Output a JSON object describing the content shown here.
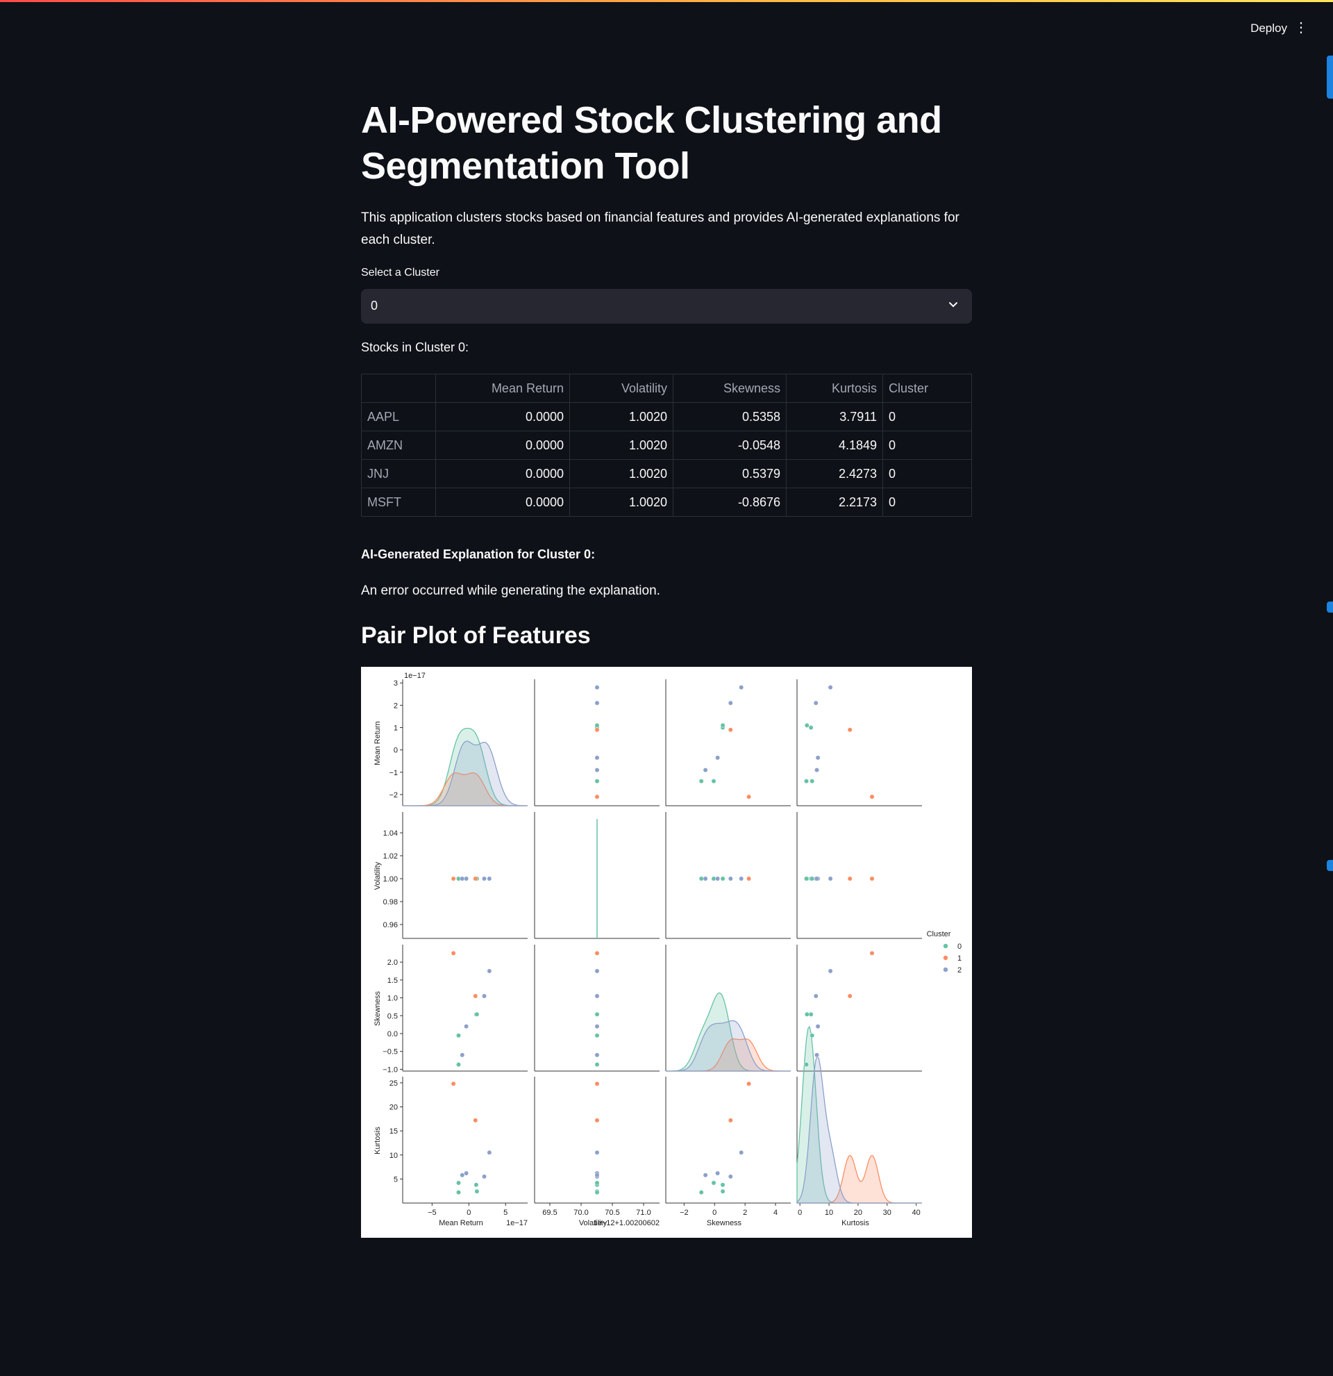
{
  "header": {
    "deploy_label": "Deploy",
    "menu_icon": "⋮"
  },
  "page": {
    "title": "AI-Powered Stock Clustering and Segmentation Tool",
    "description": "This application clusters stocks based on financial features and provides AI-generated explanations for each cluster."
  },
  "cluster_select": {
    "label": "Select a Cluster",
    "value": "0"
  },
  "stocks_label": "Stocks in Cluster 0:",
  "table": {
    "columns": [
      "",
      "Mean Return",
      "Volatility",
      "Skewness",
      "Kurtosis",
      "Cluster"
    ],
    "rows": [
      [
        "AAPL",
        "0.0000",
        "1.0020",
        "0.5358",
        "3.7911",
        "0"
      ],
      [
        "AMZN",
        "0.0000",
        "1.0020",
        "-0.0548",
        "4.1849",
        "0"
      ],
      [
        "JNJ",
        "0.0000",
        "1.0020",
        "0.5379",
        "2.4273",
        "0"
      ],
      [
        "MSFT",
        "0.0000",
        "1.0020",
        "-0.8676",
        "2.2173",
        "0"
      ]
    ]
  },
  "explanation": {
    "heading": "AI-Generated Explanation for Cluster 0:",
    "text": "An error occurred while generating the explanation."
  },
  "pairplot_heading": "Pair Plot of Features",
  "colors": {
    "c0": "#66c2a5",
    "c1": "#fc8d62",
    "c2": "#8da0cb",
    "bg": "#0e1117"
  },
  "chart_data": {
    "type": "scatter",
    "title": "",
    "variables": [
      "Mean Return",
      "Volatility",
      "Skewness",
      "Kurtosis"
    ],
    "offsets": {
      "Mean Return": "1e−17",
      "Volatility": "1e−12+1.00200602"
    },
    "legend": {
      "title": "Cluster",
      "entries": [
        "0",
        "1",
        "2"
      ],
      "placement": "right"
    },
    "ticks": {
      "Mean Return": {
        "x": [
          "−5",
          "0",
          "5"
        ],
        "y": [
          "3",
          "2",
          "1",
          "0",
          "−1",
          "−2"
        ]
      },
      "Volatility": {
        "x": [
          "69.5",
          "70.0",
          "70.5",
          "71.0"
        ],
        "y": [
          "1.04",
          "1.02",
          "1.00",
          "0.98",
          "0.96"
        ]
      },
      "Skewness": {
        "x": [
          "−2",
          "0",
          "2",
          "4"
        ],
        "y": [
          "2.0",
          "1.5",
          "1.0",
          "0.5",
          "0.0",
          "−0.5",
          "−1.0"
        ]
      },
      "Kurtosis": {
        "x": [
          "0",
          "10",
          "20",
          "30",
          "40"
        ],
        "y": [
          "25",
          "20",
          "15",
          "10",
          "5"
        ]
      }
    },
    "points": [
      {
        "cluster": 0,
        "mean_return": 1.0,
        "skewness": 0.5358,
        "kurtosis": 3.7911
      },
      {
        "cluster": 0,
        "mean_return": -1.4,
        "skewness": -0.0548,
        "kurtosis": 4.1849
      },
      {
        "cluster": 0,
        "mean_return": 1.1,
        "skewness": 0.5379,
        "kurtosis": 2.4273
      },
      {
        "cluster": 0,
        "mean_return": -1.4,
        "skewness": -0.8676,
        "kurtosis": 2.2173
      },
      {
        "cluster": 1,
        "mean_return": 0.9,
        "skewness": 1.05,
        "kurtosis": 17.2
      },
      {
        "cluster": 1,
        "mean_return": -2.1,
        "skewness": 2.25,
        "kurtosis": 24.8
      },
      {
        "cluster": 2,
        "mean_return": 2.8,
        "skewness": 1.75,
        "kurtosis": 10.5
      },
      {
        "cluster": 2,
        "mean_return": 2.1,
        "skewness": 1.05,
        "kurtosis": 5.5
      },
      {
        "cluster": 2,
        "mean_return": -0.35,
        "skewness": 0.2,
        "kurtosis": 6.2
      },
      {
        "cluster": 2,
        "mean_return": -0.9,
        "skewness": -0.6,
        "kurtosis": 5.8
      }
    ]
  }
}
